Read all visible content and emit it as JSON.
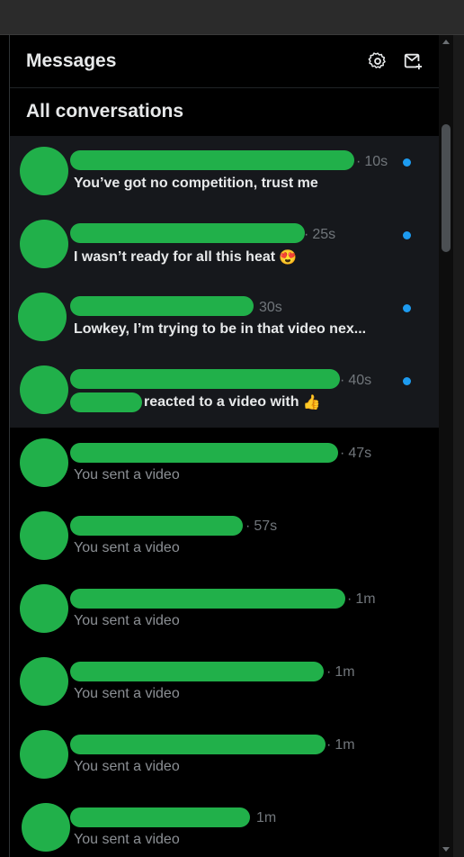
{
  "header": {
    "title": "Messages",
    "settings_icon": "gear-icon",
    "new_message_icon": "compose-message-icon"
  },
  "section": {
    "title": "All conversations"
  },
  "conversations": [
    {
      "time": "10s",
      "preview": "You’ve got no competition, trust me",
      "unread": true
    },
    {
      "time": "25s",
      "preview": "I wasn’t ready for all this heat",
      "preview_emoji": "😍",
      "unread": true
    },
    {
      "time": "30s",
      "preview": "Lowkey, I’m trying to be in that video nex...",
      "unread": true
    },
    {
      "time": "40s",
      "preview": "reacted to a video with",
      "preview_emoji": "👍",
      "unread": true
    },
    {
      "time": "47s",
      "preview": "You sent a video",
      "unread": false
    },
    {
      "time": "57s",
      "preview": "You sent a video",
      "unread": false
    },
    {
      "time": "1m",
      "preview": "You sent a video",
      "unread": false
    },
    {
      "time": "1m",
      "preview": "You sent a video",
      "unread": false
    },
    {
      "time": "1m",
      "preview": "You sent a video",
      "unread": false
    },
    {
      "time": "1m",
      "preview": "You sent a video",
      "unread": false
    }
  ],
  "colors": {
    "unread_dot": "#1d9bf0",
    "redaction": "#21b04a",
    "unread_row_bg": "#16181c"
  }
}
